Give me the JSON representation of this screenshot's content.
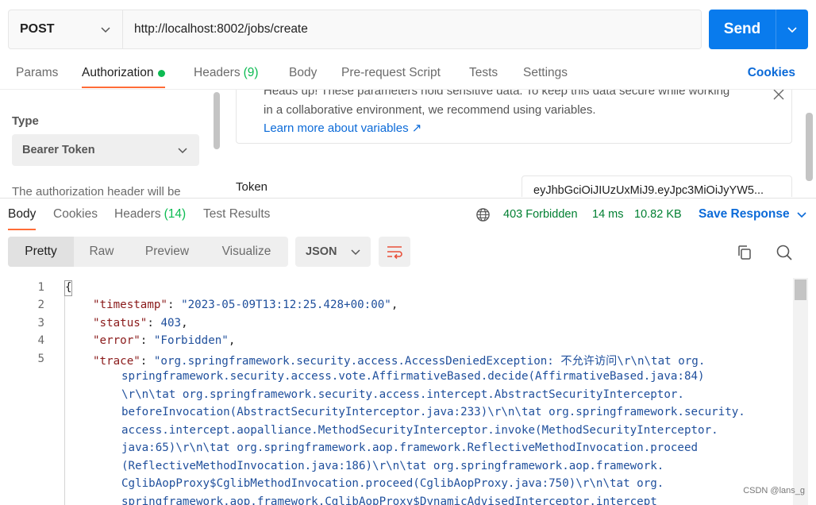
{
  "request": {
    "method": "POST",
    "url": "http://localhost:8002/jobs/create",
    "send_label": "Send"
  },
  "request_tabs": [
    {
      "label": "Params"
    },
    {
      "label": "Authorization"
    },
    {
      "label": "Headers",
      "count": "(9)"
    },
    {
      "label": "Body"
    },
    {
      "label": "Pre-request Script"
    },
    {
      "label": "Tests"
    },
    {
      "label": "Settings"
    }
  ],
  "cookies_label": "Cookies",
  "auth": {
    "type_label": "Type",
    "type_value": "Bearer Token",
    "description": "The authorization header will be",
    "notice_line1": "Heads up! These parameters hold sensitive data. To keep this data secure while working",
    "notice_line2": "in a collaborative environment, we recommend using variables.",
    "notice_link": "Learn more about variables ↗",
    "token_label": "Token",
    "token_value": "eyJhbGciOiJIUzUxMiJ9.eyJpc3MiOiJyYW5..."
  },
  "response_tabs": [
    {
      "label": "Body"
    },
    {
      "label": "Cookies"
    },
    {
      "label": "Headers",
      "count": "(14)"
    },
    {
      "label": "Test Results"
    }
  ],
  "response_status": {
    "status": "403 Forbidden",
    "time": "14 ms",
    "size": "10.82 KB",
    "save_label": "Save Response"
  },
  "view_modes": [
    "Pretty",
    "Raw",
    "Preview",
    "Visualize"
  ],
  "format": "JSON",
  "code": {
    "line_numbers": [
      "1",
      "2",
      "3",
      "4",
      "5"
    ],
    "open_brace": "{",
    "timestamp_key": "\"timestamp\"",
    "timestamp_val": "\"2023-05-09T13:12:25.428+00:00\"",
    "status_key": "\"status\"",
    "status_val": "403",
    "error_key": "\"error\"",
    "error_val": "\"Forbidden\"",
    "trace_key": "\"trace\"",
    "trace_lines": [
      "\"org.springframework.security.access.AccessDeniedException: 不允许访问\\r\\n\\tat org.",
      "springframework.security.access.vote.AffirmativeBased.decide(AffirmativeBased.java:84)",
      "\\r\\n\\tat org.springframework.security.access.intercept.AbstractSecurityInterceptor.",
      "beforeInvocation(AbstractSecurityInterceptor.java:233)\\r\\n\\tat org.springframework.security.",
      "access.intercept.aopalliance.MethodSecurityInterceptor.invoke(MethodSecurityInterceptor.",
      "java:65)\\r\\n\\tat org.springframework.aop.framework.ReflectiveMethodInvocation.proceed",
      "(ReflectiveMethodInvocation.java:186)\\r\\n\\tat org.springframework.aop.framework.",
      "CglibAopProxy$CglibMethodInvocation.proceed(CglibAopProxy.java:750)\\r\\n\\tat org.",
      "springframework.aop.framework.CglibAopProxy$DynamicAdvisedInterceptor.intercept"
    ]
  },
  "watermark": "CSDN @lans_g"
}
